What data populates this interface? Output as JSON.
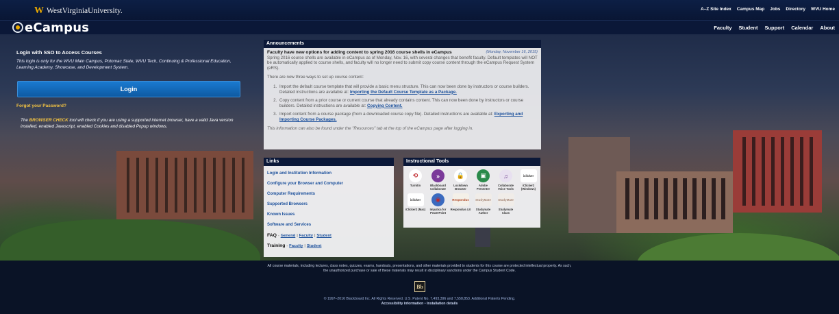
{
  "header": {
    "university_name": "WestVirginiaUniversity.",
    "app_name": "eCampus",
    "top_links": [
      "A–Z Site Index",
      "Campus Map",
      "Jobs",
      "Directory",
      "WVU Home"
    ],
    "nav_links": [
      "Faculty",
      "Student",
      "Support",
      "Calendar",
      "About"
    ]
  },
  "login": {
    "heading": "Login with SSO to Access Courses",
    "note": "This login is only for the WVU Main Campus, Potomac State, WVU Tech, Continuing & Professional Education, Learning Academy, Showcase, and Development System.",
    "button_label": "Login",
    "forgot_label": "Forgot your Password?",
    "check_pre": "The",
    "check_link": "BROWSER CHECK",
    "check_post": "tool will check if you are using a supported internet browser, have a valid Java version installed, enabled Javascript, enabled Cookies and disabled Popup windows."
  },
  "announcements": {
    "heading": "Announcements",
    "title": "Faculty have new options for adding content to spring 2016 course shells in eCampus",
    "date": "(Monday, November 16, 2015)",
    "intro": "Spring 2016 course shells are available in eCampus as of Monday, Nov. 16, with several changes that benefit faculty. Default templates will NOT be automatically applied to course shells, and faculty will no longer need to submit copy course content through the eCampus Request System (eRS).",
    "ways": "There are now three ways to set up course content:",
    "items": [
      {
        "text": "Import the default course template that will provide a basic menu structure. This can now been done by instructors or course builders. Detailed instructions are available at:",
        "link": "Importing the Default Course Template as a Package."
      },
      {
        "text": "Copy content from a prior course or current course that already contains content. This can now been done by instructors or course builders. Detailed instructions are available at:",
        "link": "Copying Content."
      },
      {
        "text": "Import content from a course package (from a downloaded course copy file). Detailed instructions are available at:",
        "link": "Exporting and Importing Course Packages."
      }
    ],
    "footer": "This information can also be found under the \"Resources\" tab at the top of the eCampus page after logging in."
  },
  "links": {
    "heading": "Links",
    "items": [
      "Login and Institution Information",
      "Configure your Browser and Computer",
      "Computer Requirements",
      "Supported Browsers",
      "Known Issues",
      "Software and Services"
    ],
    "faq": {
      "label": "FAQ",
      "dash": "-",
      "general": "General",
      "faculty": "Faculty",
      "student": "Student",
      "sep": "|"
    },
    "training": {
      "label": "Training",
      "dash": "-",
      "faculty": "Faculty",
      "student": "Student",
      "sep": "|"
    }
  },
  "tools": {
    "heading": "Instructional Tools",
    "items": [
      {
        "label": "Turnitin",
        "icon": "turnitin-icon",
        "glyph": "⟲",
        "color": "#c0282d",
        "bg": "#fff"
      },
      {
        "label": "Blackboard Collaborate",
        "icon": "collaborate-icon",
        "glyph": "»",
        "color": "#fff",
        "bg": "#7b3a9a"
      },
      {
        "label": "Lockdown Browser",
        "icon": "lock-icon",
        "glyph": "🔒",
        "color": "#111",
        "bg": "#fff"
      },
      {
        "label": "Adobe Presenter",
        "icon": "presenter-icon",
        "glyph": "▣",
        "color": "#fff",
        "bg": "#2a8a4a"
      },
      {
        "label": "Collaborate Voice Tools",
        "icon": "voice-tools-icon",
        "glyph": "♫",
        "color": "#6a3a8a",
        "bg": "#e8e0f0"
      },
      {
        "label": "iClicker2 (Windows)",
        "icon": "iclicker-icon",
        "glyph": "iclicker",
        "color": "#333",
        "bg": "#fff"
      },
      {
        "label": "iClicker2 (Mac)",
        "icon": "iclicker-mac-icon",
        "glyph": "iclicker",
        "color": "#333",
        "bg": "#fff"
      },
      {
        "label": "Impatica for PowerPoint",
        "icon": "impatica-icon",
        "glyph": "◉",
        "color": "#c0282d",
        "bg": "#3a6abf"
      },
      {
        "label": "Respondus 4.0",
        "icon": "respondus-icon",
        "glyph": "Respondus",
        "color": "#b14a2a",
        "bg": "#f4f0e8"
      },
      {
        "label": "Studymate Author",
        "icon": "studymate-author-icon",
        "glyph": "StudyMate",
        "color": "#a88a7a",
        "bg": "#f0ece8"
      },
      {
        "label": "Studymate Class",
        "icon": "studymate-class-icon",
        "glyph": "StudyMate",
        "color": "#a88a7a",
        "bg": "#f0ece8"
      }
    ]
  },
  "footer": {
    "legal": "All course materials, including lectures, class notes, quizzes, exams, handouts, presentations, and other materials provided to students for this course are protected intellectual property. As such, the unauthorized purchase or sale of these materials may result in disciplinary sanctions under the Campus Student Code.",
    "bb_logo": "Bb",
    "copyright": "© 1997–2016 Blackboard Inc. All Rights Reserved. U.S. Patent No. 7,493,396 and 7,558,853. Additional Patents Pending.",
    "accessibility": "Accessibility information",
    "bullet": "•",
    "installation": "Installation details"
  }
}
